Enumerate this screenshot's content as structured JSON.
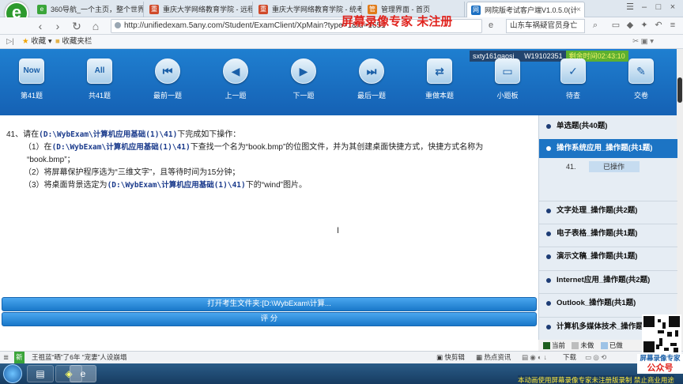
{
  "browser": {
    "tabs": [
      {
        "label": "360导航_一个主页，整个世界",
        "color": "#3aa53a"
      },
      {
        "label": "重庆大学网络教育学院 - 远程",
        "color": "#d04a2a"
      },
      {
        "label": "重庆大学网络教育学院 - 统考",
        "color": "#d04a2a"
      },
      {
        "label": "管理界面 - 首页",
        "color": "#e07b1a"
      },
      {
        "label": "网院版考试客户端V1.0.5.0(计",
        "color": "#1b6fc2"
      }
    ],
    "watermark": "屏幕录像专家  未注册",
    "url": "http://unifiedexam.5any.com/Student/ExamClient/XpMain?type=1&id=1651",
    "search": "山东车祸疑官员身亡",
    "bookmarks": {
      "favorites": "收藏",
      "folder": "收藏夹栏"
    }
  },
  "user": {
    "id": "sxty161gaosj",
    "code": "W19102351",
    "timer": "剩余时间02:43:10"
  },
  "toolbar": [
    {
      "icon": "Now",
      "label": "第41题",
      "shape": "sq"
    },
    {
      "icon": "All",
      "label": "共41题",
      "shape": "sq"
    },
    {
      "icon": "⏮",
      "label": "最前一题",
      "shape": "circ"
    },
    {
      "icon": "◀",
      "label": "上一题",
      "shape": "circ"
    },
    {
      "icon": "▶",
      "label": "下一题",
      "shape": "circ"
    },
    {
      "icon": "⏭",
      "label": "最后一题",
      "shape": "circ"
    },
    {
      "icon": "⇄",
      "label": "重做本题",
      "shape": "sq"
    },
    {
      "icon": "▭",
      "label": "小题板",
      "shape": "sq"
    },
    {
      "icon": "✓",
      "label": "待查",
      "shape": "sq"
    },
    {
      "icon": "✎",
      "label": "交卷",
      "shape": "sq"
    }
  ],
  "question": {
    "head_pre": "41、请在",
    "path1": "(D:\\WybExam\\计算机应用基础(1)\\41)",
    "head_post": "下完成如下操作：",
    "s1_pre": "（1）在",
    "s1_path": "(D:\\WybExam\\计算机应用基础(1)\\41)",
    "s1_post": "下查找一个名为“book.bmp”的位图文件，并为其创建桌面快捷方式，快捷方式名称为",
    "s1_cont": "“book.bmp”；",
    "s2": "（2）将屏幕保护程序选为“三维文字”，且等待时间为15分钟；",
    "s3_pre": "（3）将桌面背景选定为",
    "s3_path": "(D:\\WybExam\\计算机应用基础(1)\\41)",
    "s3_post": "下的“wind”图片。"
  },
  "buttons": {
    "open_folder": "打开考生文件夹:[D:\\WybExam\\计算...",
    "score": "评 分"
  },
  "panel": {
    "sections": [
      "单选题(共40题)",
      "操作系统应用_操作题(共1题)",
      "文字处理_操作题(共2题)",
      "电子表格_操作题(共1题)",
      "演示文稿_操作题(共1题)",
      "Internet应用_操作题(共2题)",
      "Outlook_操作题(共1题)",
      "计算机多媒体技术_操作题(共1题)"
    ],
    "item_num": "41.",
    "item_status": "已操作",
    "legend": {
      "current": "当前",
      "undone": "未做",
      "done": "已做",
      "current_color": "#1d5e1d",
      "undone_color": "#bdbdbd",
      "done_color": "#9ec3e6"
    }
  },
  "statusbar": {
    "news": "王祖蓝“晒”了6年 “宠妻”人设崩塌",
    "quick": "快剪辑",
    "hot": "热点资讯",
    "download": "下载"
  },
  "qr": {
    "line1": "屏幕录像专家",
    "line2": "公众号"
  },
  "bottom_note": "本动画使用屏幕录像专家未注册版录制  禁止商业用途"
}
